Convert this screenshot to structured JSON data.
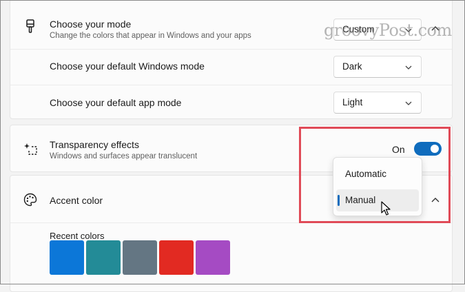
{
  "mode_section": {
    "title": "Choose your mode",
    "subtitle": "Change the colors that appear in Windows and your apps",
    "value": "Custom",
    "icon": "paintbrush-icon"
  },
  "windows_mode": {
    "title": "Choose your default Windows mode",
    "value": "Dark"
  },
  "app_mode": {
    "title": "Choose your default app mode",
    "value": "Light"
  },
  "transparency": {
    "title": "Transparency effects",
    "subtitle": "Windows and surfaces appear translucent",
    "state_label": "On",
    "icon": "sparkle-icon"
  },
  "accent": {
    "title": "Accent color",
    "icon": "palette-icon",
    "menu": {
      "options": [
        "Automatic",
        "Manual"
      ],
      "selected": "Manual"
    },
    "recent_colors_label": "Recent colors",
    "recent_colors": [
      "#0c77d8",
      "#238b97",
      "#647683",
      "#e22a22",
      "#a54bc3"
    ]
  },
  "colors": {
    "accent": "#0f6cbd",
    "highlight_box": "#e04a57"
  },
  "watermark": "groovyPost.com"
}
